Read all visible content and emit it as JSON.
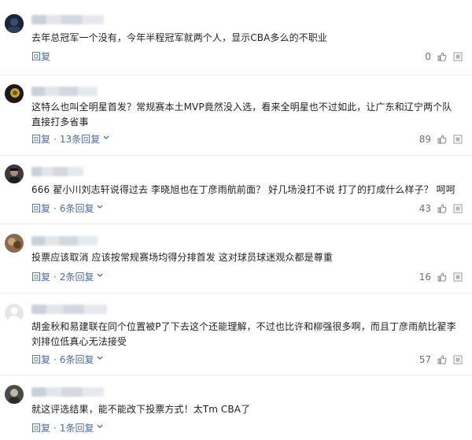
{
  "comments": [
    {
      "text": "去年总冠军一个没有，今年半程冠军就两个人，显示CBA多么的不职业",
      "reply_label": "回复",
      "reply_count": "",
      "likes": "0",
      "avatar": "dark-blue"
    },
    {
      "text": "这特么也叫全明星首发？常规赛本土MVP竟然没入选，看来全明星也不过如此，让广东和辽宁两个队直接打多省事",
      "reply_label": "回复",
      "reply_count": "13条回复",
      "likes": "89",
      "avatar": "dark-yellow"
    },
    {
      "text": "666 翟小川刘志轩说得过去 李晓旭也在丁彦雨航前面？ 好几场没打不说 打了的打成什么样子？ 呵呵",
      "reply_label": "回复",
      "reply_count": "6条回复",
      "likes": "43",
      "avatar": "dark-photo"
    },
    {
      "text": "投票应该取消 应该按常规赛场均得分排首发 这对球员球迷观众都是尊重",
      "reply_label": "回复",
      "reply_count": "2条回复",
      "likes": "16",
      "avatar": "brown"
    },
    {
      "text": "胡金秋和易建联在同个位置被P了下去这个还能理解，不过也比许和柳强很多啊，而且丁彦雨航比翟李刘排位低真心无法接受",
      "reply_label": "回复",
      "reply_count": "6条回复",
      "likes": "57",
      "avatar": "default"
    },
    {
      "text": "就这评选结果，能不能改下投票方式！太Tm CBA了",
      "reply_label": "回复",
      "reply_count": "1条回复",
      "likes": "",
      "avatar": "dark-photo"
    }
  ],
  "sep": "·",
  "icons": {
    "like": "thumbs-up-icon",
    "more": "more-icon",
    "expand": "chevron-down-icon"
  },
  "colors": {
    "link": "#4a6da1",
    "text": "#1f1f1f",
    "meta_gray": "#6f6f6f"
  }
}
